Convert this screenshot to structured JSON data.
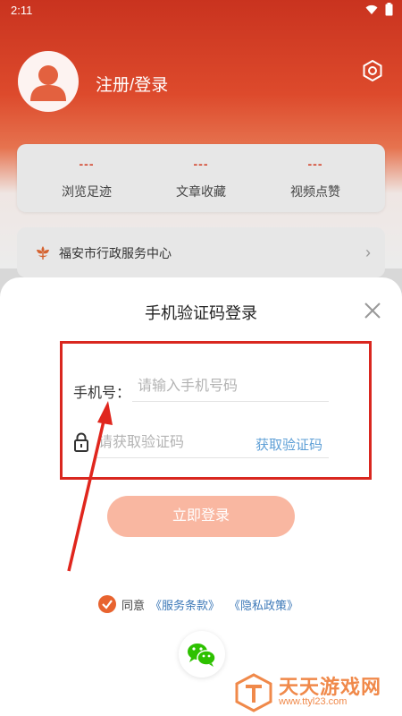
{
  "status_bar": {
    "time": "2:11"
  },
  "profile": {
    "login_label": "注册/登录"
  },
  "stats": [
    {
      "value": "---",
      "label": "浏览足迹"
    },
    {
      "value": "---",
      "label": "文章收藏"
    },
    {
      "value": "---",
      "label": "视频点赞"
    }
  ],
  "service": {
    "label": "福安市行政服务中心"
  },
  "login_sheet": {
    "title": "手机验证码登录",
    "phone_label": "手机号：",
    "phone_placeholder": "请输入手机号码",
    "phone_value": "",
    "code_placeholder": "请获取验证码",
    "code_value": "",
    "get_code_label": "获取验证码",
    "login_button_label": "立即登录",
    "agree_text": "同意",
    "terms_link": "《服务条款》",
    "privacy_link": "《隐私政策》"
  },
  "watermark": {
    "name": "天天游戏网",
    "url": "www.ttyl23.com"
  },
  "colors": {
    "header_red": "#c9331f",
    "accent_orange": "#e8632f",
    "login_button": "#f9b7a1",
    "link_blue": "#3d79b8",
    "annotation_red": "#d9271f"
  },
  "icons": {
    "settings": "gear-icon",
    "avatar": "user-avatar-icon",
    "service": "flower-icon",
    "close": "close-icon",
    "lock": "lock-icon",
    "check": "check-icon",
    "wechat": "wechat-icon"
  }
}
